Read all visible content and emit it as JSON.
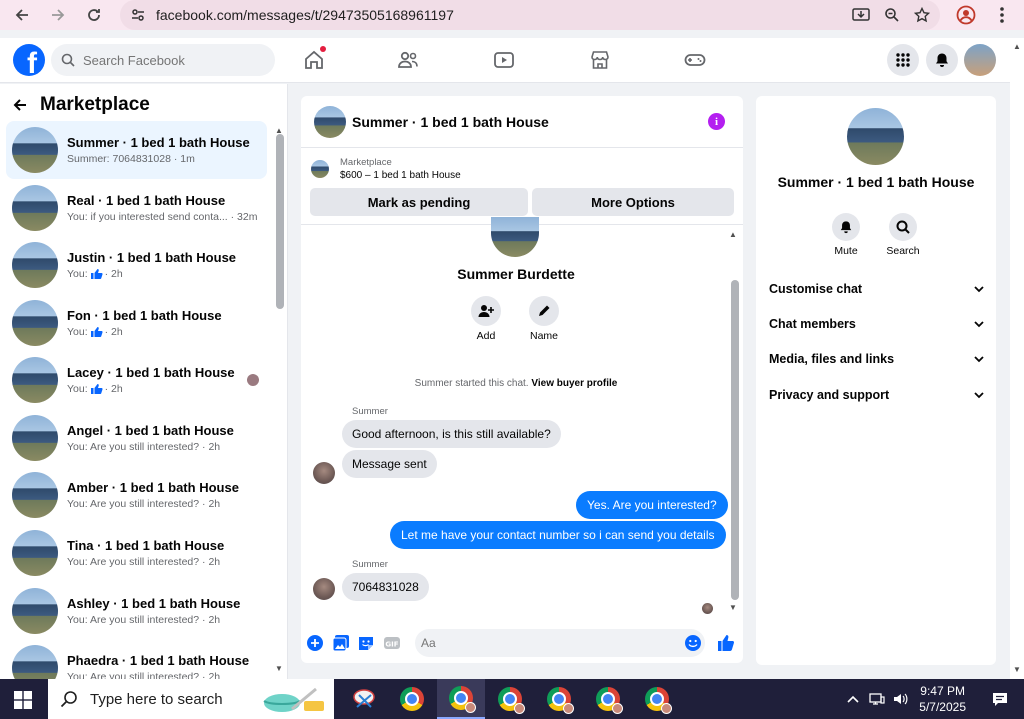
{
  "browser": {
    "url": "facebook.com/messages/t/29473505168961197"
  },
  "fb": {
    "search_placeholder": "Search Facebook"
  },
  "left": {
    "title": "Marketplace",
    "conversations": [
      {
        "name": "Summer · 1 bed 1 bath House",
        "sub": "Summer: 7064831028 · 1m",
        "active": true
      },
      {
        "name": "Real · 1 bed 1 bath House",
        "sub": "You: if you interested send conta... · 32m"
      },
      {
        "name": "Justin · 1 bed 1 bath House",
        "sub_prefix": "You:",
        "sub_suffix": "· 2h"
      },
      {
        "name": "Fon · 1 bed 1 bath House",
        "sub_prefix": "You:",
        "sub_suffix": "· 2h"
      },
      {
        "name": "Lacey · 1 bed 1 bath House",
        "sub_prefix": "You:",
        "sub_suffix": "· 2h"
      },
      {
        "name": "Angel · 1 bed 1 bath House",
        "sub": "You: Are you still interested? · 2h"
      },
      {
        "name": "Amber · 1 bed 1 bath House",
        "sub": "You: Are you still interested? · 2h"
      },
      {
        "name": "Tina · 1 bed 1 bath House",
        "sub": "You: Are you still interested? · 2h"
      },
      {
        "name": "Ashley · 1 bed 1 bath House",
        "sub": "You: Are you still interested? · 2h"
      },
      {
        "name": "Phaedra · 1 bed 1 bath House",
        "sub": "You: Are you still interested? · 2h"
      }
    ]
  },
  "chat": {
    "title": "Summer · 1 bed 1 bath House",
    "listing_category": "Marketplace",
    "listing_price": "$600 – 1 bed 1 bath House",
    "mark_pending": "Mark as pending",
    "more_options": "More Options",
    "person_name": "Summer Burdette",
    "add_label": "Add",
    "name_label": "Name",
    "system_text": "Summer started this chat.",
    "system_link": "View buyer profile",
    "sender1": "Summer",
    "msg1": "Good afternoon, is this still available?",
    "msg2": "Message sent",
    "out1": "Yes. Are you interested?",
    "out2": "Let me have your contact number so i can send you details",
    "sender2": "Summer",
    "msg3": "7064831028",
    "composer_placeholder": "Aa"
  },
  "right": {
    "name": "Summer · 1 bed 1 bath House",
    "mute_label": "Mute",
    "search_label": "Search",
    "sections": [
      "Customise chat",
      "Chat members",
      "Media, files and links",
      "Privacy and support"
    ]
  },
  "taskbar": {
    "search_placeholder": "Type here to search",
    "time": "9:47 PM",
    "date": "5/7/2025"
  },
  "colors": {
    "fb_blue": "#0866ff",
    "out_bubble": "#0a7cff",
    "info_purple": "#b41ff0"
  }
}
